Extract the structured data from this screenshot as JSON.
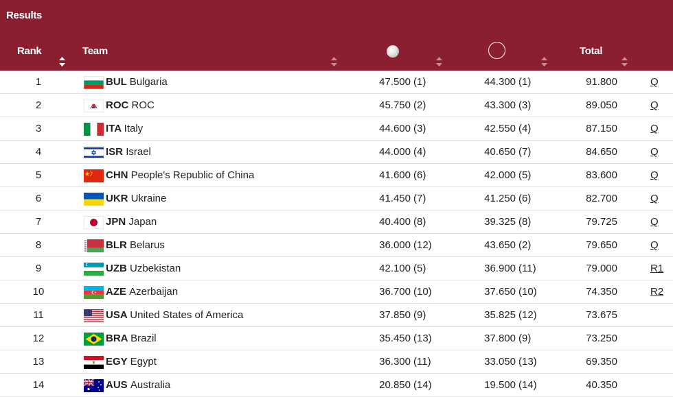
{
  "header": {
    "title": "Results",
    "columns": {
      "rank": "Rank",
      "team": "Team",
      "total": "Total"
    },
    "icons": [
      "ball-icon",
      "hoop-icon",
      "sort-icon"
    ],
    "bg_color": "#8a1f2f"
  },
  "rows": [
    {
      "rank": "1",
      "code": "BUL",
      "name": "Bulgaria",
      "s1": "47.500",
      "r1": "(1)",
      "s2": "44.300",
      "r2": "(1)",
      "total": "91.800",
      "q": "Q"
    },
    {
      "rank": "2",
      "code": "ROC",
      "name": "ROC",
      "s1": "45.750",
      "r1": "(2)",
      "s2": "43.300",
      "r2": "(3)",
      "total": "89.050",
      "q": "Q"
    },
    {
      "rank": "3",
      "code": "ITA",
      "name": "Italy",
      "s1": "44.600",
      "r1": "(3)",
      "s2": "42.550",
      "r2": "(4)",
      "total": "87.150",
      "q": "Q"
    },
    {
      "rank": "4",
      "code": "ISR",
      "name": "Israel",
      "s1": "44.000",
      "r1": "(4)",
      "s2": "40.650",
      "r2": "(7)",
      "total": "84.650",
      "q": "Q"
    },
    {
      "rank": "5",
      "code": "CHN",
      "name": "People's Republic of China",
      "s1": "41.600",
      "r1": "(6)",
      "s2": "42.000",
      "r2": "(5)",
      "total": "83.600",
      "q": "Q"
    },
    {
      "rank": "6",
      "code": "UKR",
      "name": "Ukraine",
      "s1": "41.450",
      "r1": "(7)",
      "s2": "41.250",
      "r2": "(6)",
      "total": "82.700",
      "q": "Q"
    },
    {
      "rank": "7",
      "code": "JPN",
      "name": "Japan",
      "s1": "40.400",
      "r1": "(8)",
      "s2": "39.325",
      "r2": "(8)",
      "total": "79.725",
      "q": "Q"
    },
    {
      "rank": "8",
      "code": "BLR",
      "name": "Belarus",
      "s1": "36.000",
      "r1": "(12)",
      "s2": "43.650",
      "r2": "(2)",
      "total": "79.650",
      "q": "Q"
    },
    {
      "rank": "9",
      "code": "UZB",
      "name": "Uzbekistan",
      "s1": "42.100",
      "r1": "(5)",
      "s2": "36.900",
      "r2": "(11)",
      "total": "79.000",
      "q": "R1"
    },
    {
      "rank": "10",
      "code": "AZE",
      "name": "Azerbaijan",
      "s1": "36.700",
      "r1": "(10)",
      "s2": "37.650",
      "r2": "(10)",
      "total": "74.350",
      "q": "R2"
    },
    {
      "rank": "11",
      "code": "USA",
      "name": "United States of America",
      "s1": "37.850",
      "r1": "(9)",
      "s2": "35.825",
      "r2": "(12)",
      "total": "73.675",
      "q": ""
    },
    {
      "rank": "12",
      "code": "BRA",
      "name": "Brazil",
      "s1": "35.450",
      "r1": "(13)",
      "s2": "37.800",
      "r2": "(9)",
      "total": "73.250",
      "q": ""
    },
    {
      "rank": "13",
      "code": "EGY",
      "name": "Egypt",
      "s1": "36.300",
      "r1": "(11)",
      "s2": "33.050",
      "r2": "(13)",
      "total": "69.350",
      "q": ""
    },
    {
      "rank": "14",
      "code": "AUS",
      "name": "Australia",
      "s1": "20.850",
      "r1": "(14)",
      "s2": "19.500",
      "r2": "(14)",
      "total": "40.350",
      "q": ""
    }
  ]
}
